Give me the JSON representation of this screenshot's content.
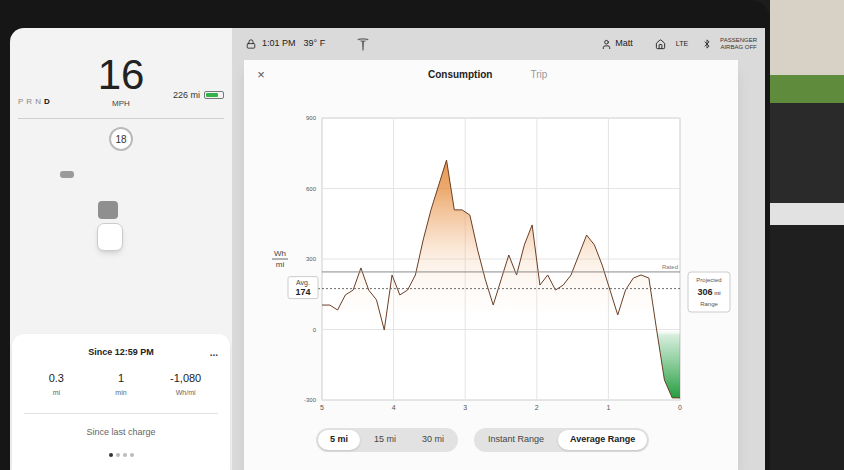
{
  "top_bar": {
    "time": "1:01 PM",
    "temperature": "39° F",
    "user": "Matt",
    "network": "LTE",
    "airbag_status": [
      "PASSENGER",
      "AIRBAG OFF"
    ]
  },
  "drive": {
    "gears": [
      {
        "label": "P",
        "selected": false
      },
      {
        "label": "R",
        "selected": false
      },
      {
        "label": "N",
        "selected": false
      },
      {
        "label": "D",
        "selected": true
      }
    ],
    "speed": "16",
    "speed_unit": "MPH",
    "range": "226 mi",
    "battery_level": 0.75,
    "speed_limit": "18"
  },
  "trip_card": {
    "title": "Since 12:59 PM",
    "menu": "...",
    "stats": [
      {
        "value": "0.3",
        "unit": "mi"
      },
      {
        "value": "1",
        "unit": "min"
      },
      {
        "value": "-1,080",
        "unit": "Wh/mi"
      }
    ],
    "footer": "Since last charge",
    "pages": [
      {
        "selected": true
      },
      {
        "selected": false
      },
      {
        "selected": false
      },
      {
        "selected": false
      }
    ]
  },
  "dialog": {
    "close": "×",
    "tabs": [
      {
        "label": "Consumption",
        "selected": true
      },
      {
        "label": "Trip",
        "selected": false
      }
    ],
    "chart": {
      "unit_top": "Wh",
      "unit_bottom": "mi",
      "y_ticks": [
        "900",
        "600",
        "300",
        "0",
        "-300"
      ],
      "x_ticks": [
        "5",
        "4",
        "3",
        "2",
        "1",
        "0"
      ],
      "series": [
        104,
        104,
        83,
        147,
        168,
        262,
        168,
        126,
        -2,
        232,
        147,
        168,
        232,
        381,
        509,
        615,
        721,
        509,
        509,
        487,
        338,
        211,
        104,
        211,
        317,
        232,
        360,
        445,
        189,
        232,
        168,
        189,
        232,
        317,
        402,
        360,
        274,
        168,
        62,
        168,
        219,
        232,
        219,
        -2,
        -215,
        -291,
        -291
      ],
      "average": 174,
      "avg_label": "Avg.",
      "avg_value": "174",
      "rated": 245,
      "rated_label": "Rated",
      "projected": {
        "label": "Projected",
        "value": "306",
        "unit": "mi",
        "caption": "Range"
      }
    },
    "distance_options": [
      {
        "label": "5 mi",
        "selected": true
      },
      {
        "label": "15 mi",
        "selected": false
      },
      {
        "label": "30 mi",
        "selected": false
      }
    ],
    "range_modes": [
      {
        "label": "Instant Range",
        "selected": false
      },
      {
        "label": "Average Range",
        "selected": true
      }
    ]
  }
}
